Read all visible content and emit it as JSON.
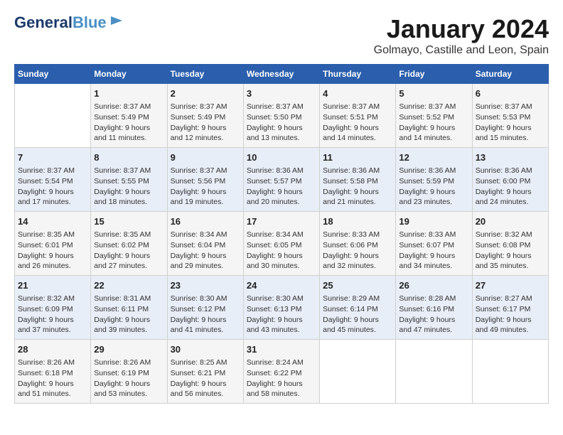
{
  "header": {
    "logo_line1": "General",
    "logo_line2": "Blue",
    "month": "January 2024",
    "location": "Golmayo, Castille and Leon, Spain"
  },
  "days_of_week": [
    "Sunday",
    "Monday",
    "Tuesday",
    "Wednesday",
    "Thursday",
    "Friday",
    "Saturday"
  ],
  "weeks": [
    [
      {
        "day": "",
        "info": ""
      },
      {
        "day": "1",
        "info": "Sunrise: 8:37 AM\nSunset: 5:49 PM\nDaylight: 9 hours\nand 11 minutes."
      },
      {
        "day": "2",
        "info": "Sunrise: 8:37 AM\nSunset: 5:49 PM\nDaylight: 9 hours\nand 12 minutes."
      },
      {
        "day": "3",
        "info": "Sunrise: 8:37 AM\nSunset: 5:50 PM\nDaylight: 9 hours\nand 13 minutes."
      },
      {
        "day": "4",
        "info": "Sunrise: 8:37 AM\nSunset: 5:51 PM\nDaylight: 9 hours\nand 14 minutes."
      },
      {
        "day": "5",
        "info": "Sunrise: 8:37 AM\nSunset: 5:52 PM\nDaylight: 9 hours\nand 14 minutes."
      },
      {
        "day": "6",
        "info": "Sunrise: 8:37 AM\nSunset: 5:53 PM\nDaylight: 9 hours\nand 15 minutes."
      }
    ],
    [
      {
        "day": "7",
        "info": "Sunrise: 8:37 AM\nSunset: 5:54 PM\nDaylight: 9 hours\nand 17 minutes."
      },
      {
        "day": "8",
        "info": "Sunrise: 8:37 AM\nSunset: 5:55 PM\nDaylight: 9 hours\nand 18 minutes."
      },
      {
        "day": "9",
        "info": "Sunrise: 8:37 AM\nSunset: 5:56 PM\nDaylight: 9 hours\nand 19 minutes."
      },
      {
        "day": "10",
        "info": "Sunrise: 8:36 AM\nSunset: 5:57 PM\nDaylight: 9 hours\nand 20 minutes."
      },
      {
        "day": "11",
        "info": "Sunrise: 8:36 AM\nSunset: 5:58 PM\nDaylight: 9 hours\nand 21 minutes."
      },
      {
        "day": "12",
        "info": "Sunrise: 8:36 AM\nSunset: 5:59 PM\nDaylight: 9 hours\nand 23 minutes."
      },
      {
        "day": "13",
        "info": "Sunrise: 8:36 AM\nSunset: 6:00 PM\nDaylight: 9 hours\nand 24 minutes."
      }
    ],
    [
      {
        "day": "14",
        "info": "Sunrise: 8:35 AM\nSunset: 6:01 PM\nDaylight: 9 hours\nand 26 minutes."
      },
      {
        "day": "15",
        "info": "Sunrise: 8:35 AM\nSunset: 6:02 PM\nDaylight: 9 hours\nand 27 minutes."
      },
      {
        "day": "16",
        "info": "Sunrise: 8:34 AM\nSunset: 6:04 PM\nDaylight: 9 hours\nand 29 minutes."
      },
      {
        "day": "17",
        "info": "Sunrise: 8:34 AM\nSunset: 6:05 PM\nDaylight: 9 hours\nand 30 minutes."
      },
      {
        "day": "18",
        "info": "Sunrise: 8:33 AM\nSunset: 6:06 PM\nDaylight: 9 hours\nand 32 minutes."
      },
      {
        "day": "19",
        "info": "Sunrise: 8:33 AM\nSunset: 6:07 PM\nDaylight: 9 hours\nand 34 minutes."
      },
      {
        "day": "20",
        "info": "Sunrise: 8:32 AM\nSunset: 6:08 PM\nDaylight: 9 hours\nand 35 minutes."
      }
    ],
    [
      {
        "day": "21",
        "info": "Sunrise: 8:32 AM\nSunset: 6:09 PM\nDaylight: 9 hours\nand 37 minutes."
      },
      {
        "day": "22",
        "info": "Sunrise: 8:31 AM\nSunset: 6:11 PM\nDaylight: 9 hours\nand 39 minutes."
      },
      {
        "day": "23",
        "info": "Sunrise: 8:30 AM\nSunset: 6:12 PM\nDaylight: 9 hours\nand 41 minutes."
      },
      {
        "day": "24",
        "info": "Sunrise: 8:30 AM\nSunset: 6:13 PM\nDaylight: 9 hours\nand 43 minutes."
      },
      {
        "day": "25",
        "info": "Sunrise: 8:29 AM\nSunset: 6:14 PM\nDaylight: 9 hours\nand 45 minutes."
      },
      {
        "day": "26",
        "info": "Sunrise: 8:28 AM\nSunset: 6:16 PM\nDaylight: 9 hours\nand 47 minutes."
      },
      {
        "day": "27",
        "info": "Sunrise: 8:27 AM\nSunset: 6:17 PM\nDaylight: 9 hours\nand 49 minutes."
      }
    ],
    [
      {
        "day": "28",
        "info": "Sunrise: 8:26 AM\nSunset: 6:18 PM\nDaylight: 9 hours\nand 51 minutes."
      },
      {
        "day": "29",
        "info": "Sunrise: 8:26 AM\nSunset: 6:19 PM\nDaylight: 9 hours\nand 53 minutes."
      },
      {
        "day": "30",
        "info": "Sunrise: 8:25 AM\nSunset: 6:21 PM\nDaylight: 9 hours\nand 56 minutes."
      },
      {
        "day": "31",
        "info": "Sunrise: 8:24 AM\nSunset: 6:22 PM\nDaylight: 9 hours\nand 58 minutes."
      },
      {
        "day": "",
        "info": ""
      },
      {
        "day": "",
        "info": ""
      },
      {
        "day": "",
        "info": ""
      }
    ]
  ]
}
